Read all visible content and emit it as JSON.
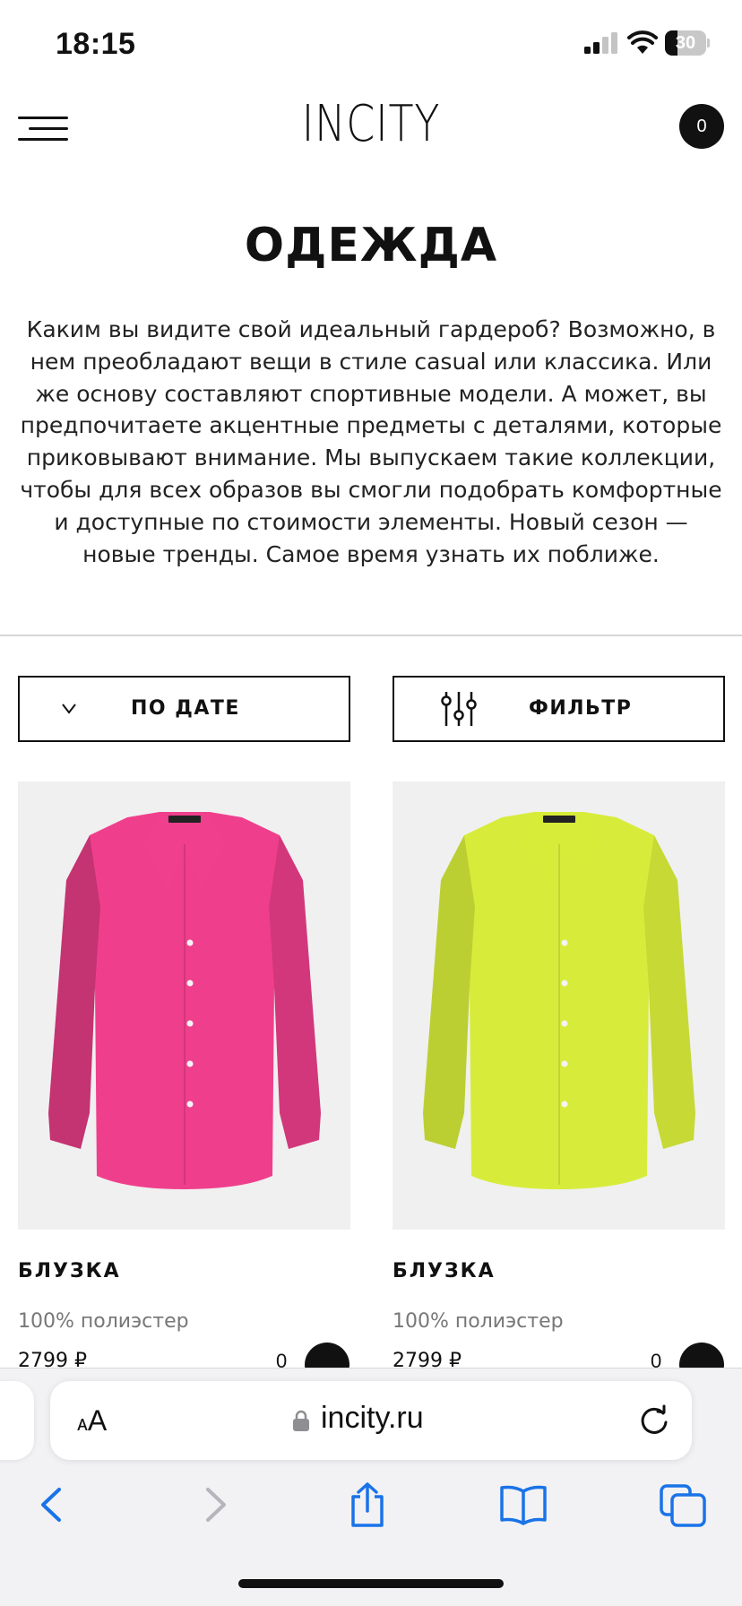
{
  "status_bar": {
    "time": "18:15",
    "battery_level": "30",
    "battery_fraction": 0.3
  },
  "header": {
    "logo": "INCITY",
    "cart_count": "0"
  },
  "page": {
    "title": "ОДЕЖДА",
    "description": "Каким вы видите свой идеальный гардероб? Возможно, в нем преобладают вещи в стиле casual или классика. Или же основу составляют спортивные модели. А может, вы предпочитаете акцентные предметы с деталями, которые приковывают внимание. Мы выпускаем такие коллекции, чтобы для всех образов вы смогли подобрать комфортные и доступные по стоимости элементы. Новый сезон — новые тренды. Самое время узнать их поближе."
  },
  "controls": {
    "sort_label": "ПО ДАТЕ",
    "filter_label": "ФИЛЬТР"
  },
  "products": [
    {
      "name": "БЛУЗКА",
      "material": "100% полиэстер",
      "price": "2799 ₽",
      "count": "0",
      "color": "#ef3f8c"
    },
    {
      "name": "БЛУЗКА",
      "material": "100% полиэстер",
      "price": "2799 ₽",
      "count": "0",
      "color": "#d7ec3a"
    }
  ],
  "browser": {
    "text_size_label": "AA",
    "url": "incity.ru"
  },
  "icons": {
    "menu": "hamburger-menu-icon",
    "sort": "chevron-down-icon",
    "filter": "sliders-icon",
    "lock": "lock-icon",
    "reload": "reload-icon",
    "back": "back-arrow-icon",
    "forward": "forward-arrow-icon",
    "share": "share-icon",
    "bookmarks": "bookmarks-book-icon",
    "tabs": "tabs-icon"
  }
}
